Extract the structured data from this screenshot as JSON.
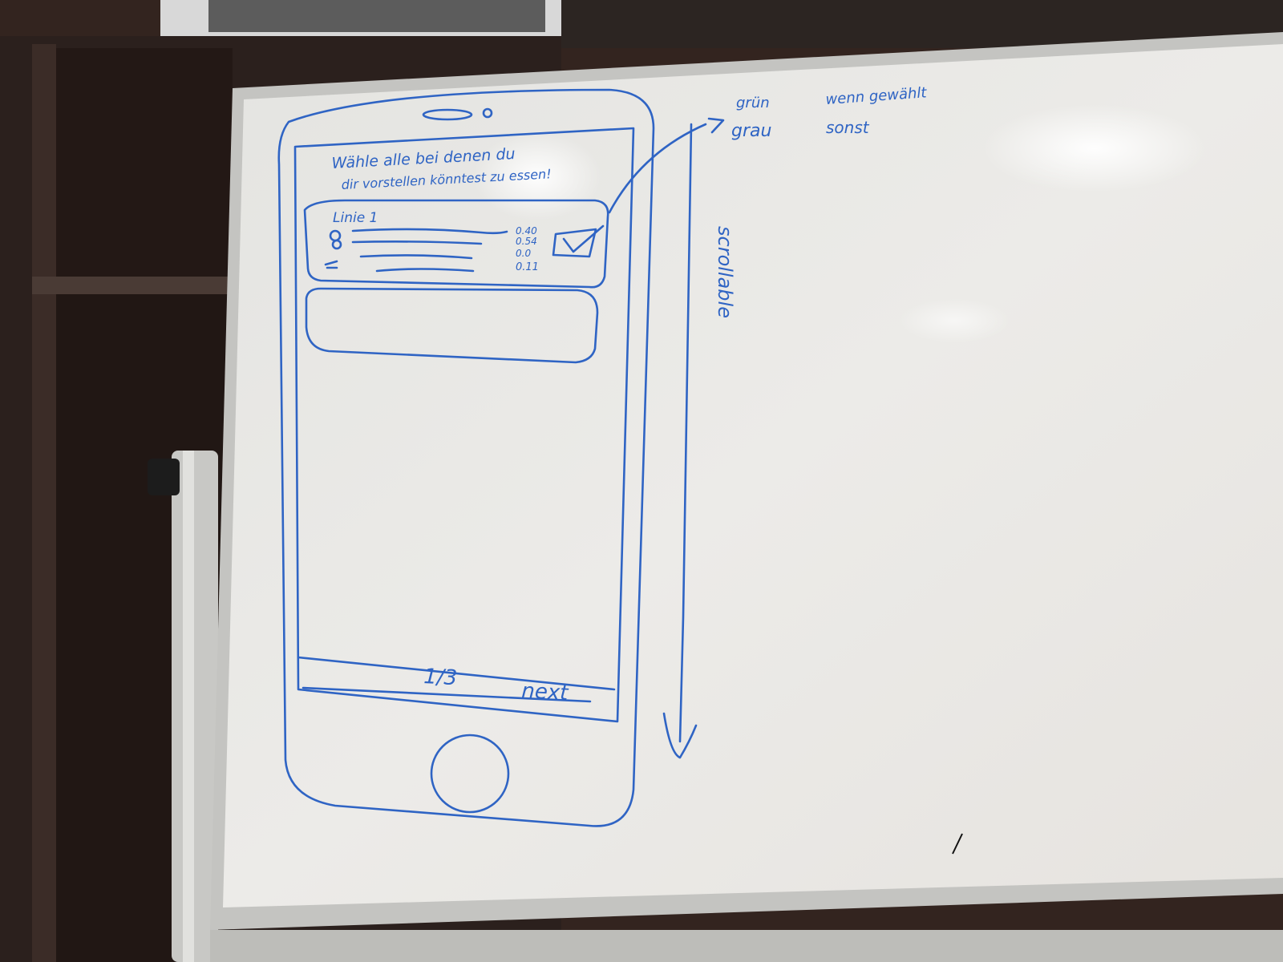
{
  "whiteboard": {
    "sketch": {
      "instruction_line1": "Wähle alle bei denen du",
      "instruction_line2": "dir vorstellen könntest zu essen!",
      "card_title": "Linie 1",
      "prices": [
        "0.40",
        "0.54",
        "0.0",
        "0.11"
      ],
      "pager": "1/3",
      "next_label": "next"
    },
    "annotations": {
      "green_word": "grün",
      "green_rest": "wenn gewählt",
      "grey_word": "grau",
      "grey_rest": "sonst",
      "scroll_label": "scrollable"
    }
  },
  "colors": {
    "marker": "#2f64c4",
    "board": "#ecebe7",
    "frame": "#c9c9c6",
    "furniture": "#2e221f"
  }
}
